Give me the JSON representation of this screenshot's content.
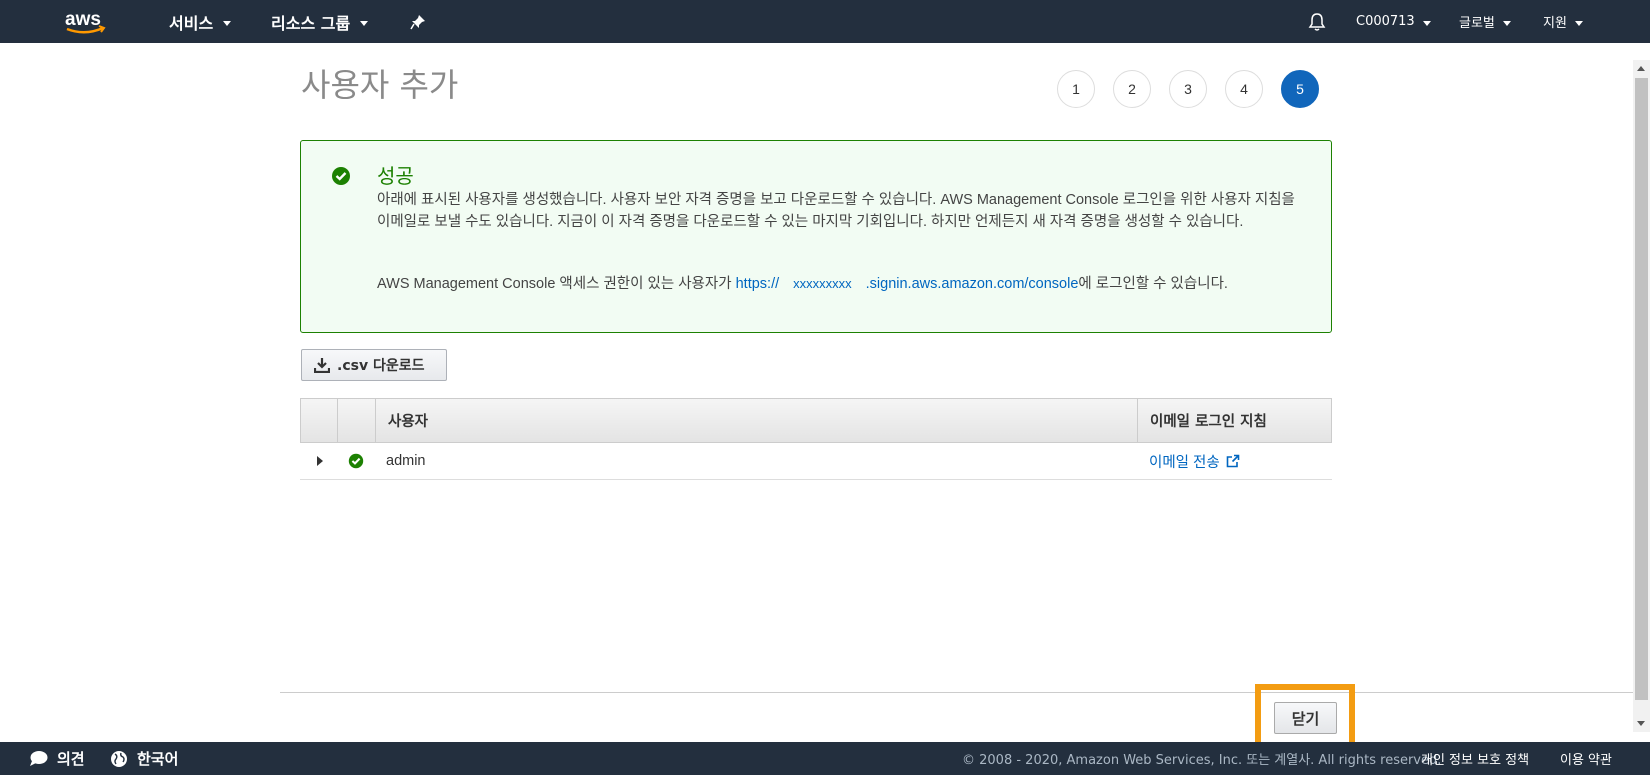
{
  "nav": {
    "logo_text": "aws",
    "services": "서비스",
    "resource_groups": "리소스 그룹",
    "account": "C000713",
    "region": "글로벌",
    "support": "지원"
  },
  "page": {
    "title": "사용자 추가",
    "steps": [
      "1",
      "2",
      "3",
      "4",
      "5"
    ],
    "active_step": "5"
  },
  "success": {
    "heading": "성공",
    "message": "아래에 표시된 사용자를 생성했습니다. 사용자 보안 자격 증명을 보고 다운로드할 수 있습니다. AWS Management Console 로그인을 위한 사용자 지침을 이메일로 보낼 수도 있습니다. 지금이 이 자격 증명을 다운로드할 수 있는 마지막 기회입니다. 하지만 언제든지 새 자격 증명을 생성할 수 있습니다.",
    "console_prefix": "AWS Management Console 액세스 권한이 있는 사용자가 ",
    "url_part1": "https://",
    "url_account": "xxxxxxxxx",
    "url_part2": ".signin.aws.amazon.com/console",
    "console_suffix": "에 로그인할 수 있습니다."
  },
  "csv_button": ".csv 다운로드",
  "table": {
    "headers": [
      "",
      "",
      "사용자",
      "이메일 로그인 지침"
    ],
    "rows": [
      {
        "user": "admin",
        "email_action": "이메일 전송"
      }
    ]
  },
  "close_button": "닫기",
  "footer": {
    "feedback": "의견",
    "language": "한국어",
    "copyright": "© 2008 - 2020, Amazon Web Services, Inc. 또는 계열사. All rights reserved.",
    "privacy": "개인 정보 보호 정책",
    "terms": "이용 약관"
  },
  "colors": {
    "nav_bg": "#232f3e",
    "accent_orange": "#ff9900",
    "success_green": "#1d8102",
    "link_blue": "#0066c0",
    "step_active": "#1166bb",
    "highlight": "#f39c12"
  }
}
